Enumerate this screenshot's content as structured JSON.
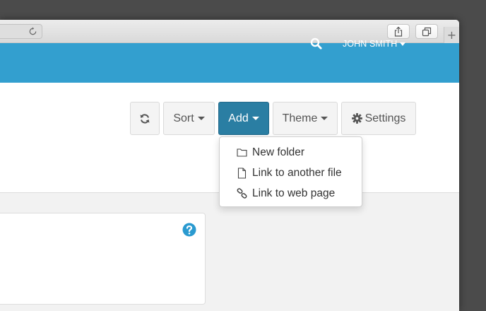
{
  "colors": {
    "navbar": "#339fcf",
    "accent_button": "#2a7ea3",
    "help_icon": "#2a9ad0"
  },
  "navbar": {
    "user_label": "JOHN SMITH",
    "icons": [
      "search-icon",
      "chevron-down-icon"
    ]
  },
  "toolbar": {
    "refresh_icon": "refresh-icon",
    "sort_label": "Sort",
    "add_label": "Add",
    "theme_label": "Theme",
    "settings_label": "Settings",
    "settings_icon": "gear-icon"
  },
  "add_menu": {
    "items": [
      {
        "label": "New folder",
        "icon": "folder-icon"
      },
      {
        "label": "Link to another file",
        "icon": "file-icon"
      },
      {
        "label": "Link to web page",
        "icon": "link-icon"
      }
    ]
  },
  "panel": {
    "help_icon": "question-circle-icon"
  }
}
